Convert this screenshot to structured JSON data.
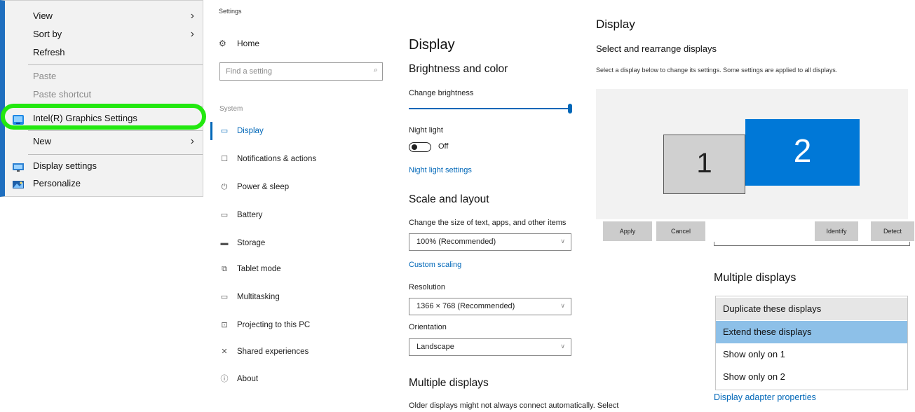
{
  "context_menu": {
    "items": [
      {
        "label": "View",
        "submenu": true,
        "disabled": false
      },
      {
        "label": "Sort by",
        "submenu": true,
        "disabled": false
      },
      {
        "label": "Refresh",
        "submenu": false,
        "disabled": false
      },
      {
        "label": "Paste",
        "submenu": false,
        "disabled": true
      },
      {
        "label": "Paste shortcut",
        "submenu": false,
        "disabled": true
      },
      {
        "label": "Intel(R) Graphics Settings",
        "submenu": false,
        "disabled": false,
        "icon": "intel-graphics-icon"
      },
      {
        "label": "New",
        "submenu": true,
        "disabled": false
      },
      {
        "label": "Display settings",
        "submenu": false,
        "disabled": false,
        "icon": "display-settings-icon"
      },
      {
        "label": "Personalize",
        "submenu": false,
        "disabled": false,
        "icon": "personalize-icon"
      }
    ],
    "highlight_color": "#22e80f"
  },
  "settings_nav": {
    "window_title": "Settings",
    "home_label": "Home",
    "search_placeholder": "Find a setting",
    "section_label": "System",
    "items": [
      {
        "label": "Display",
        "icon": "monitor-icon",
        "active": true
      },
      {
        "label": "Notifications & actions",
        "icon": "notifications-icon",
        "active": false
      },
      {
        "label": "Power & sleep",
        "icon": "power-icon",
        "active": false
      },
      {
        "label": "Battery",
        "icon": "battery-icon",
        "active": false
      },
      {
        "label": "Storage",
        "icon": "storage-icon",
        "active": false
      },
      {
        "label": "Tablet mode",
        "icon": "tablet-mode-icon",
        "active": false
      },
      {
        "label": "Multitasking",
        "icon": "multitasking-icon",
        "active": false
      },
      {
        "label": "Projecting to this PC",
        "icon": "projecting-icon",
        "active": false
      },
      {
        "label": "Shared experiences",
        "icon": "shared-experiences-icon",
        "active": false
      },
      {
        "label": "About",
        "icon": "about-icon",
        "active": false
      }
    ],
    "accent": "#0067b8"
  },
  "display_page": {
    "title": "Display",
    "brightness_heading": "Brightness and color",
    "brightness_label": "Change brightness",
    "brightness_value_percent": 100,
    "night_light_label": "Night light",
    "night_light_state": "Off",
    "night_light_settings_link": "Night light settings",
    "scale_heading": "Scale and layout",
    "scale_label": "Change the size of text, apps, and other items",
    "scale_value": "100% (Recommended)",
    "custom_scaling_link": "Custom scaling",
    "resolution_label": "Resolution",
    "resolution_value": "1366 × 768 (Recommended)",
    "orientation_label": "Orientation",
    "orientation_value": "Landscape",
    "multiple_heading": "Multiple displays",
    "multiple_text": "Older displays might not always connect automatically. Select"
  },
  "display_panel": {
    "title": "Display",
    "subtitle": "Select and rearrange displays",
    "description": "Select a display below to change its settings. Some settings are applied to all displays.",
    "monitor_1": "1",
    "monitor_2": "2",
    "apply_label": "Apply",
    "cancel_label": "Cancel",
    "identify_label": "Identify",
    "detect_label": "Detect",
    "multiple_heading": "Multiple displays",
    "options": [
      "Duplicate these displays",
      "Extend these displays",
      "Show only on 1",
      "Show only on 2"
    ],
    "selected_option": "Extend these displays",
    "adapter_link": "Display adapter properties",
    "monitor_2_color": "#0078d7"
  }
}
